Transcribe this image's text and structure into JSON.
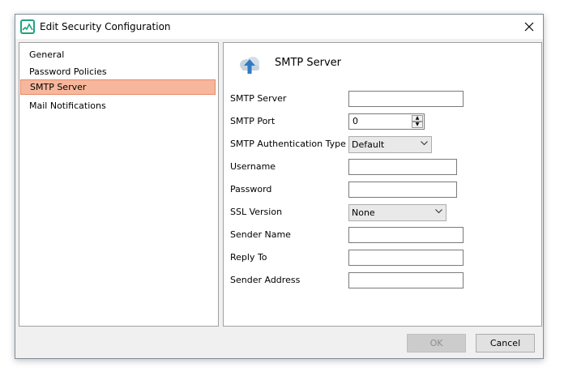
{
  "window": {
    "title": "Edit Security Configuration",
    "close_glyph": "✕"
  },
  "nav": {
    "items": [
      {
        "label": "General"
      },
      {
        "label": "Password Policies"
      },
      {
        "label": "SMTP Server"
      },
      {
        "label": "Mail Notifications"
      }
    ],
    "selected": "SMTP Server"
  },
  "section": {
    "icon": "cloud-upload-icon",
    "title": "SMTP Server"
  },
  "form": {
    "smtp_server_label": "SMTP Server",
    "smtp_server_value": "",
    "smtp_port_label": "SMTP Port",
    "smtp_port_value": "0",
    "auth_type_label": "SMTP Authentication Type",
    "auth_type_value": "Default",
    "username_label": "Username",
    "username_value": "",
    "password_label": "Password",
    "password_value": "",
    "ssl_label": "SSL Version",
    "ssl_value": "None",
    "sender_name_label": "Sender Name",
    "sender_name_value": "",
    "reply_to_label": "Reply To",
    "reply_to_value": "",
    "sender_address_label": "Sender Address",
    "sender_address_value": ""
  },
  "buttons": {
    "ok_label": "OK",
    "cancel_label": "Cancel"
  },
  "colors": {
    "selection_bg": "#f7b79c",
    "app_icon": "#1ea47e",
    "accent_icon": "#2e7bc4"
  }
}
